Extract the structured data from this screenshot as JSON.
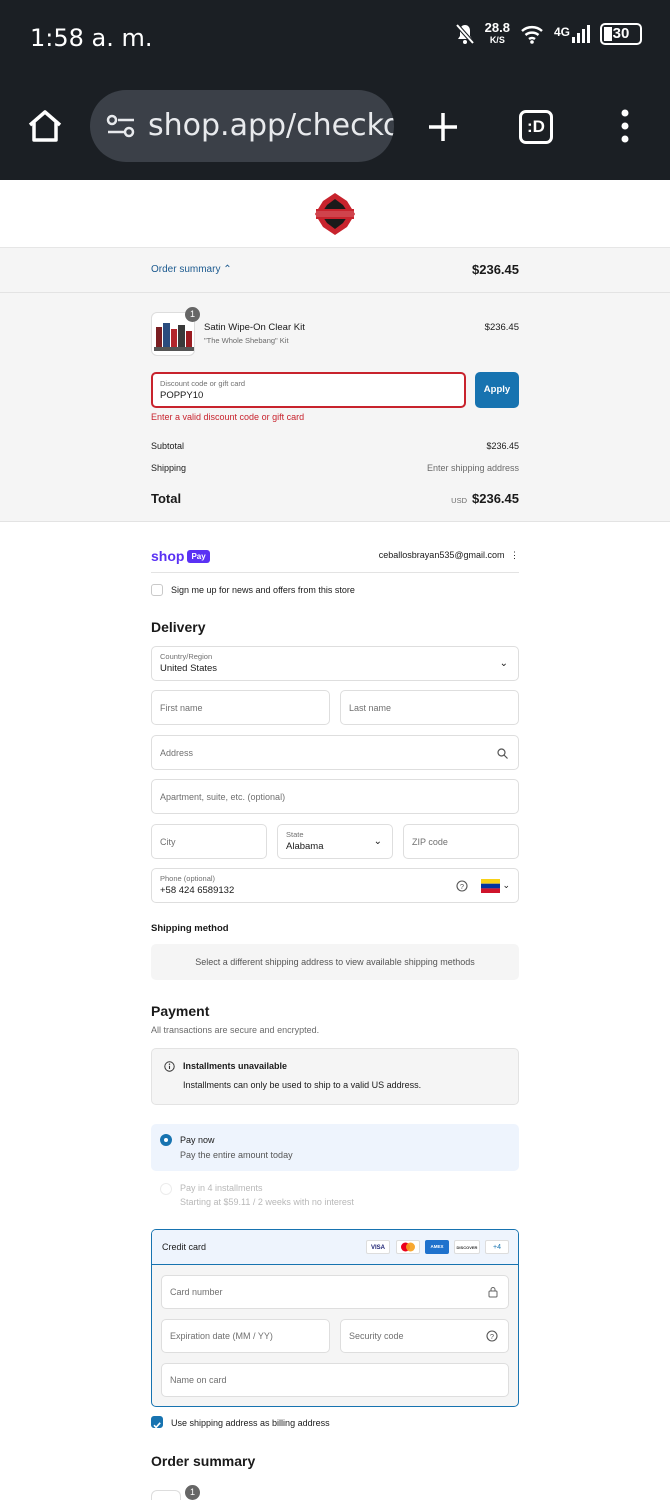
{
  "status_bar": {
    "time": "1:58 a. m.",
    "speed": "28.8",
    "speed_unit": "K/S",
    "network": "4G",
    "battery": "30"
  },
  "browser": {
    "url": "shop.app/checko",
    "tab_label": ":D"
  },
  "order_summary_bar": {
    "toggle_label": "Order summary",
    "price": "$236.45"
  },
  "product": {
    "quantity": "1",
    "name": "Satin Wipe-On Clear Kit",
    "variant": "\"The Whole Shebang\" Kit",
    "price": "$236.45"
  },
  "discount": {
    "label": "Discount code or gift card",
    "value": "POPPY10",
    "apply_label": "Apply",
    "error": "Enter a valid discount code or gift card"
  },
  "totals": {
    "subtotal_label": "Subtotal",
    "subtotal_value": "$236.45",
    "shipping_label": "Shipping",
    "shipping_value": "Enter shipping address",
    "total_label": "Total",
    "currency": "USD",
    "total_value": "$236.45"
  },
  "account": {
    "shop_label": "shop",
    "pay_label": "Pay",
    "email": "ceballosbrayan535@gmail.com",
    "newsletter_label": "Sign me up for news and offers from this store"
  },
  "delivery": {
    "heading": "Delivery",
    "country_label": "Country/Region",
    "country_value": "United States",
    "first_name": "First name",
    "last_name": "Last name",
    "address": "Address",
    "apartment": "Apartment, suite, etc. (optional)",
    "city": "City",
    "state_label": "State",
    "state_value": "Alabama",
    "zip": "ZIP code",
    "phone_label": "Phone (optional)",
    "phone_value": "+58 424 6589132"
  },
  "shipping_method": {
    "heading": "Shipping method",
    "notice": "Select a different shipping address to view available shipping methods"
  },
  "payment": {
    "heading": "Payment",
    "subtitle": "All transactions are secure and encrypted.",
    "installments_title": "Installments unavailable",
    "installments_body": "Installments can only be used to ship to a valid US address.",
    "paynow_title": "Pay now",
    "paynow_sub": "Pay the entire amount today",
    "pay4_title": "Pay in 4 installments",
    "pay4_sub": "Starting at $59.11 / 2 weeks with no interest",
    "credit_card_label": "Credit card",
    "cards": [
      "VISA",
      "AMEX",
      "DISCOVER"
    ],
    "more_cards": "+4",
    "card_number": "Card number",
    "expiration": "Expiration date (MM / YY)",
    "security": "Security code",
    "name_on_card": "Name on card",
    "billing_label": "Use shipping address as billing address"
  },
  "footer": {
    "order_summary_heading": "Order summary",
    "quantity": "1"
  },
  "colors": {
    "accent": "#1773b0",
    "error": "#c8232d",
    "shop_purple": "#5a31f4",
    "browser_bg": "#1b1f24"
  }
}
